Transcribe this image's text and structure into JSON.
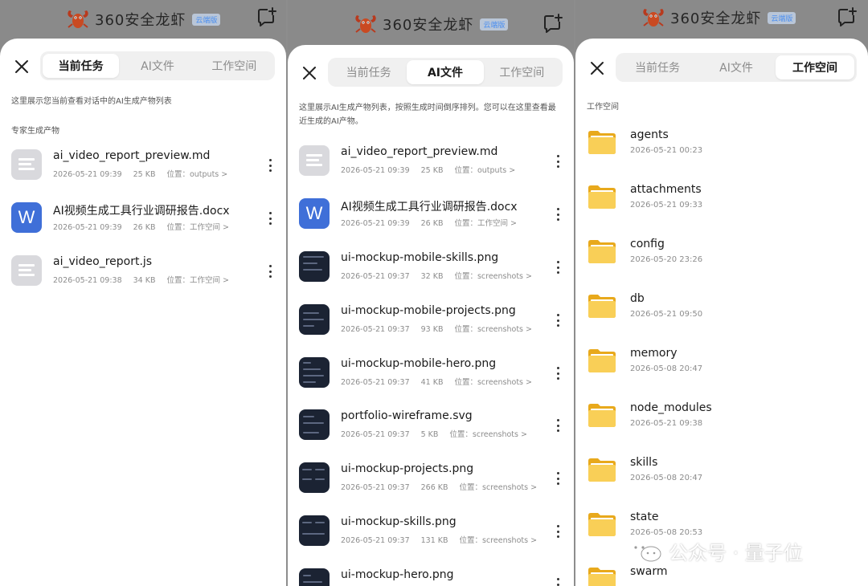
{
  "app": {
    "brand_name": "360安全龙虾",
    "version_tag": "云端版"
  },
  "tabs": [
    "当前任务",
    "AI文件",
    "工作空间"
  ],
  "panel1": {
    "active_tab": 0,
    "description": "这里展示您当前查看对话中的AI生成产物列表",
    "section_title": "专家生成产物",
    "files": [
      {
        "name": "ai_video_report_preview.md",
        "date": "2026-05-21 09:39",
        "size": "25 KB",
        "location": "位置：outputs >",
        "icon": "text-file-icon"
      },
      {
        "name": "AI视频生成工具行业调研报告.docx",
        "date": "2026-05-21 09:39",
        "size": "26 KB",
        "location": "位置：工作空间 >",
        "icon": "word-doc-icon"
      },
      {
        "name": "ai_video_report.js",
        "date": "2026-05-21 09:38",
        "size": "34 KB",
        "location": "位置：工作空间 >",
        "icon": "text-file-icon"
      }
    ]
  },
  "panel2": {
    "active_tab": 1,
    "description": "这里展示AI生成产物列表，按照生成时间倒序排列。您可以在这里查看最近生成的AI产物。",
    "files": [
      {
        "name": "ai_video_report_preview.md",
        "date": "2026-05-21 09:39",
        "size": "25 KB",
        "location": "位置：outputs >",
        "icon": "text-file-icon"
      },
      {
        "name": "AI视频生成工具行业调研报告.docx",
        "date": "2026-05-21 09:39",
        "size": "26 KB",
        "location": "位置：工作空间 >",
        "icon": "word-doc-icon"
      },
      {
        "name": "ui-mockup-mobile-skills.png",
        "date": "2026-05-21 09:37",
        "size": "32 KB",
        "location": "位置：screenshots >",
        "icon": "image-thumbnail-icon"
      },
      {
        "name": "ui-mockup-mobile-projects.png",
        "date": "2026-05-21 09:37",
        "size": "93 KB",
        "location": "位置：screenshots >",
        "icon": "image-thumbnail-icon"
      },
      {
        "name": "ui-mockup-mobile-hero.png",
        "date": "2026-05-21 09:37",
        "size": "41 KB",
        "location": "位置：screenshots >",
        "icon": "image-thumbnail-icon"
      },
      {
        "name": "portfolio-wireframe.svg",
        "date": "2026-05-21 09:37",
        "size": "5 KB",
        "location": "位置：screenshots >",
        "icon": "image-thumbnail-icon"
      },
      {
        "name": "ui-mockup-projects.png",
        "date": "2026-05-21 09:37",
        "size": "266 KB",
        "location": "位置：screenshots >",
        "icon": "image-thumbnail-icon"
      },
      {
        "name": "ui-mockup-skills.png",
        "date": "2026-05-21 09:37",
        "size": "131 KB",
        "location": "位置：screenshots >",
        "icon": "image-thumbnail-icon"
      },
      {
        "name": "ui-mockup-hero.png",
        "date": "",
        "size": "",
        "location": "",
        "icon": "image-thumbnail-icon"
      }
    ]
  },
  "panel3": {
    "active_tab": 2,
    "section_title": "工作空间",
    "folders": [
      {
        "name": "agents",
        "date": "2026-05-21 00:23"
      },
      {
        "name": "attachments",
        "date": "2026-05-21 09:33"
      },
      {
        "name": "config",
        "date": "2026-05-20 23:26"
      },
      {
        "name": "db",
        "date": "2026-05-21 09:50"
      },
      {
        "name": "memory",
        "date": "2026-05-08 20:47"
      },
      {
        "name": "node_modules",
        "date": "2026-05-21 09:38"
      },
      {
        "name": "skills",
        "date": "2026-05-08 20:47"
      },
      {
        "name": "state",
        "date": "2026-05-08 20:53"
      },
      {
        "name": "swarm",
        "date": ""
      }
    ]
  },
  "watermark": "公众号 · 量子位",
  "colors": {
    "accent_blue": "#3f6fd8",
    "folder_yellow": "#f7c948",
    "tag_blue": "#4b8ff0"
  }
}
